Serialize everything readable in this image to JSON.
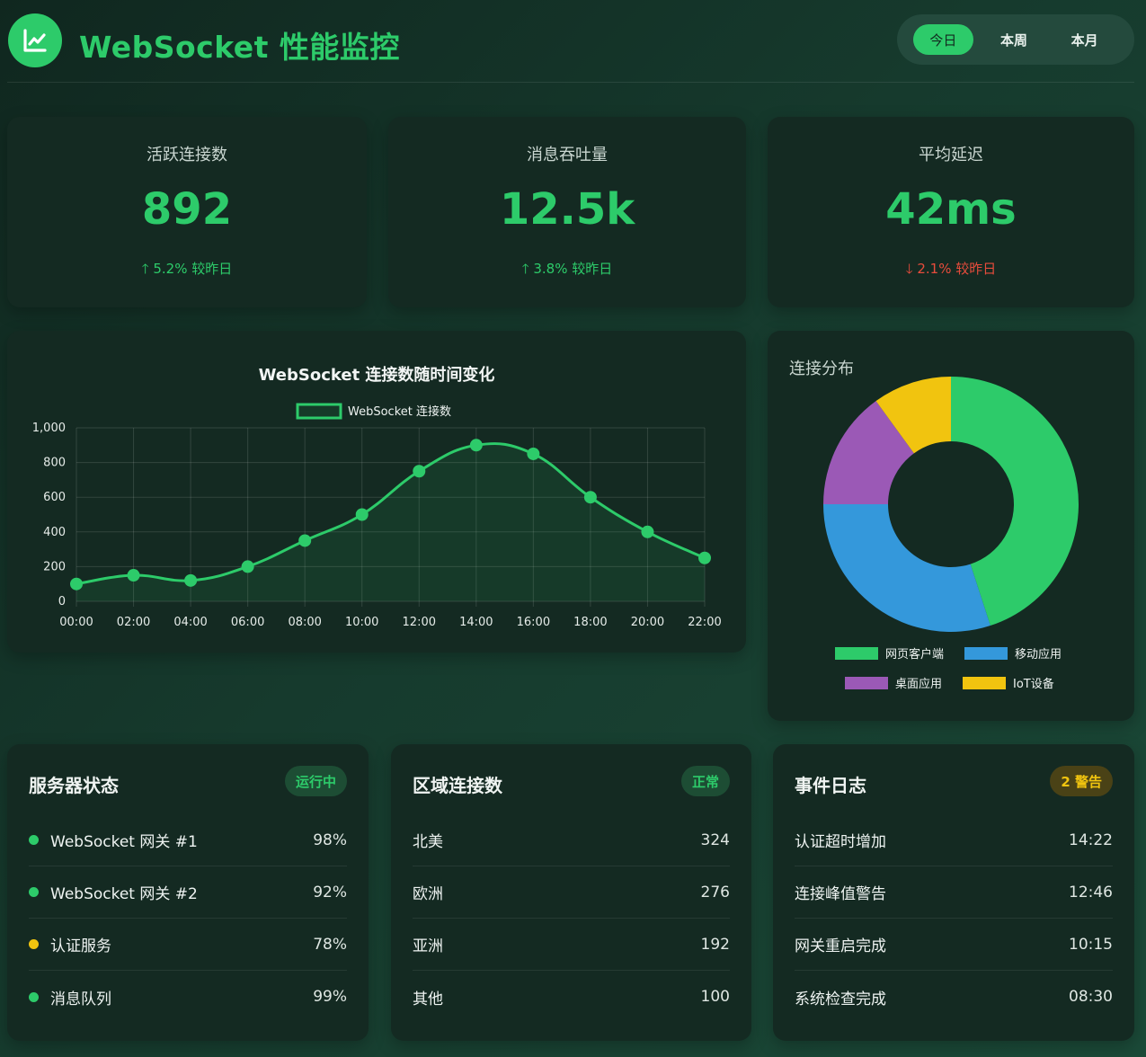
{
  "header": {
    "title": "WebSocket 性能监控",
    "logo_icon": "chart-line-icon",
    "ranges": [
      "今日",
      "本周",
      "本月"
    ],
    "active_range": "今日"
  },
  "stats": [
    {
      "label": "活跃连接数",
      "value": "892",
      "change": "5.2% 较昨日",
      "direction": "up"
    },
    {
      "label": "消息吞吐量",
      "value": "12.5k",
      "change": "3.8% 较昨日",
      "direction": "up"
    },
    {
      "label": "平均延迟",
      "value": "42ms",
      "change": "2.1% 较昨日",
      "direction": "down"
    }
  ],
  "colors": {
    "accent": "#2dcb6a",
    "down": "#e74c3c",
    "blue": "#3498db",
    "purple": "#9b59b6",
    "yellow": "#f1c40f"
  },
  "chart_data": [
    {
      "type": "line",
      "title": "WebSocket 连接数随时间变化",
      "legend_position": "top",
      "x": [
        "00:00",
        "02:00",
        "04:00",
        "06:00",
        "08:00",
        "10:00",
        "12:00",
        "14:00",
        "16:00",
        "18:00",
        "20:00",
        "22:00"
      ],
      "series": [
        {
          "name": "WebSocket 连接数",
          "values": [
            100,
            150,
            120,
            200,
            350,
            500,
            750,
            900,
            850,
            600,
            400,
            250
          ]
        }
      ],
      "ylim": [
        0,
        1000
      ],
      "yticks": [
        "0",
        "200",
        "400",
        "600",
        "800",
        "1,000"
      ],
      "grid": true,
      "fill": true
    },
    {
      "type": "pie",
      "title": "连接分布",
      "legend_position": "bottom",
      "categories": [
        "网页客户端",
        "移动应用",
        "桌面应用",
        "IoT设备"
      ],
      "values": [
        45,
        30,
        15,
        10
      ],
      "colors": [
        "#2dcb6a",
        "#3498db",
        "#9b59b6",
        "#f1c40f"
      ]
    }
  ],
  "server_status": {
    "title": "服务器状态",
    "badge": "运行中",
    "items": [
      {
        "name": "WebSocket 网关 #1",
        "value": "98%",
        "status": "ok"
      },
      {
        "name": "WebSocket 网关 #2",
        "value": "92%",
        "status": "ok"
      },
      {
        "name": "认证服务",
        "value": "78%",
        "status": "warn"
      },
      {
        "name": "消息队列",
        "value": "99%",
        "status": "ok"
      }
    ]
  },
  "regions": {
    "title": "区域连接数",
    "badge": "正常",
    "items": [
      {
        "name": "北美",
        "value": "324"
      },
      {
        "name": "欧洲",
        "value": "276"
      },
      {
        "name": "亚洲",
        "value": "192"
      },
      {
        "name": "其他",
        "value": "100"
      }
    ]
  },
  "events": {
    "title": "事件日志",
    "badge": "2 警告",
    "items": [
      {
        "name": "认证超时增加",
        "value": "14:22"
      },
      {
        "name": "连接峰值警告",
        "value": "12:46"
      },
      {
        "name": "网关重启完成",
        "value": "10:15"
      },
      {
        "name": "系统检查完成",
        "value": "08:30"
      }
    ]
  }
}
